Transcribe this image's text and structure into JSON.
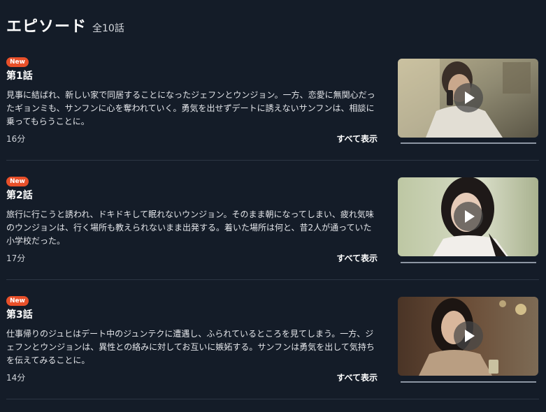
{
  "header": {
    "title": "エピソード",
    "count": "全10話"
  },
  "episodes": [
    {
      "badge": "New",
      "title": "第1話",
      "description": "見事に結ばれ、新しい家で同居することになったジェフンとウンジョン。一方、恋愛に無関心だったギョンミも、サンフンに心を奪われていく。勇気を出せずデートに誘えないサンフンは、相談に乗ってもらうことに。",
      "duration": "16分",
      "show_all": "すべて表示",
      "play_icon": "play-icon",
      "progress": 0
    },
    {
      "badge": "New",
      "title": "第2話",
      "description": "旅行に行こうと誘われ、ドキドキして眠れないウンジョン。そのまま朝になってしまい、疲れ気味のウンジョンは、行く場所も教えられないまま出発する。着いた場所は何と、昔2人が通っていた小学校だった。",
      "duration": "17分",
      "show_all": "すべて表示",
      "play_icon": "play-icon",
      "progress": 0
    },
    {
      "badge": "New",
      "title": "第3話",
      "description": "仕事帰りのジュヒはデート中のジュンテクに遭遇し、ふられているところを見てしまう。一方、ジェフンとウンジョンは、異性との絡みに対してお互いに嫉妬する。サンフンは勇気を出して気持ちを伝えてみることに。",
      "duration": "14分",
      "show_all": "すべて表示",
      "play_icon": "play-icon",
      "progress": 0
    }
  ]
}
